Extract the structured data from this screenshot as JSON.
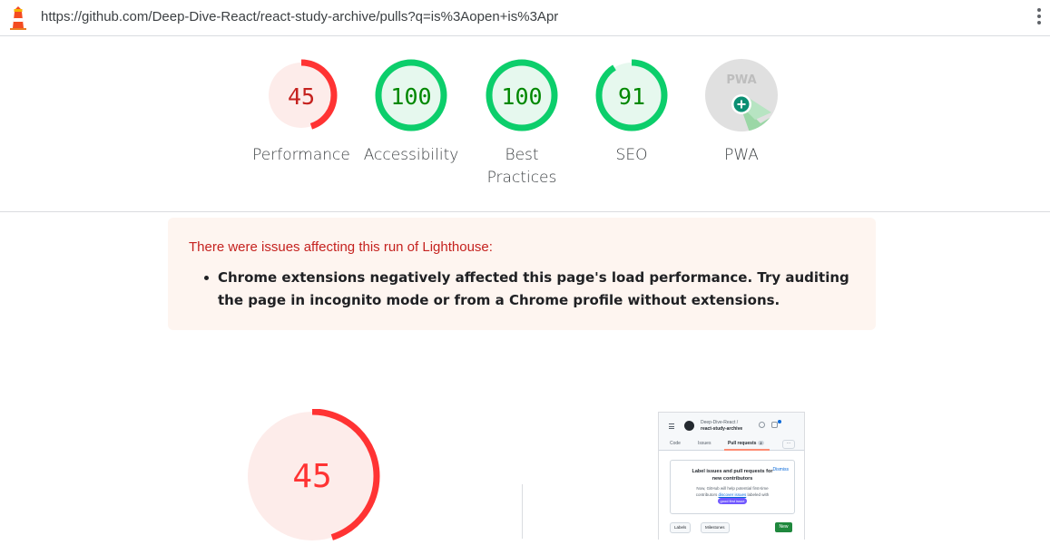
{
  "address_bar": {
    "url": "https://github.com/Deep-Dive-React/react-study-archive/pulls?q=is%3Aopen+is%3Apr",
    "menu_icon": "kebab-menu-icon",
    "logo_icon": "lighthouse-icon"
  },
  "scores": [
    {
      "label": "Performance",
      "value": "45",
      "score": 45,
      "color": "#ff3333",
      "fill": "#fdecea",
      "text_color": "#c5221f"
    },
    {
      "label": "Accessibility",
      "value": "100",
      "score": 100,
      "color": "#0cce6b",
      "fill": "#e6f8ee",
      "text_color": "#008800"
    },
    {
      "label": "Best Practices",
      "value": "100",
      "score": 100,
      "color": "#0cce6b",
      "fill": "#e6f8ee",
      "text_color": "#008800"
    },
    {
      "label": "SEO",
      "value": "91",
      "score": 91,
      "color": "#0cce6b",
      "fill": "#e6f8ee",
      "text_color": "#008800"
    },
    {
      "label": "PWA",
      "badge_text": "PWA",
      "icon": "pwa-badge-icon"
    }
  ],
  "warning": {
    "title": "There were issues affecting this run of Lighthouse:",
    "items": [
      "Chrome extensions negatively affected this page's load performance. Try auditing the page in incognito mode or from a Chrome profile without extensions."
    ]
  },
  "performance_detail": {
    "value": "45",
    "score": 45,
    "color": "#ff3333",
    "fill": "#fdecea"
  },
  "screenshot_thumbnail": {
    "repo_owner": "Deep-Dive-React /",
    "repo_name": "react-study-archive",
    "tabs": [
      "Code",
      "Issues",
      "Pull requests"
    ],
    "pr_count": "2",
    "card_title": "Label issues and pull requests for new contributors",
    "dismiss": "Dismiss",
    "card_body_1": "Now, GitHub will help potential first-time contributors",
    "card_link": "discover issues",
    "card_body_2": "labeled with",
    "card_label": "good first issue",
    "labels_btn": "Labels",
    "milestones_btn": "Milestones",
    "new_btn": "New"
  }
}
